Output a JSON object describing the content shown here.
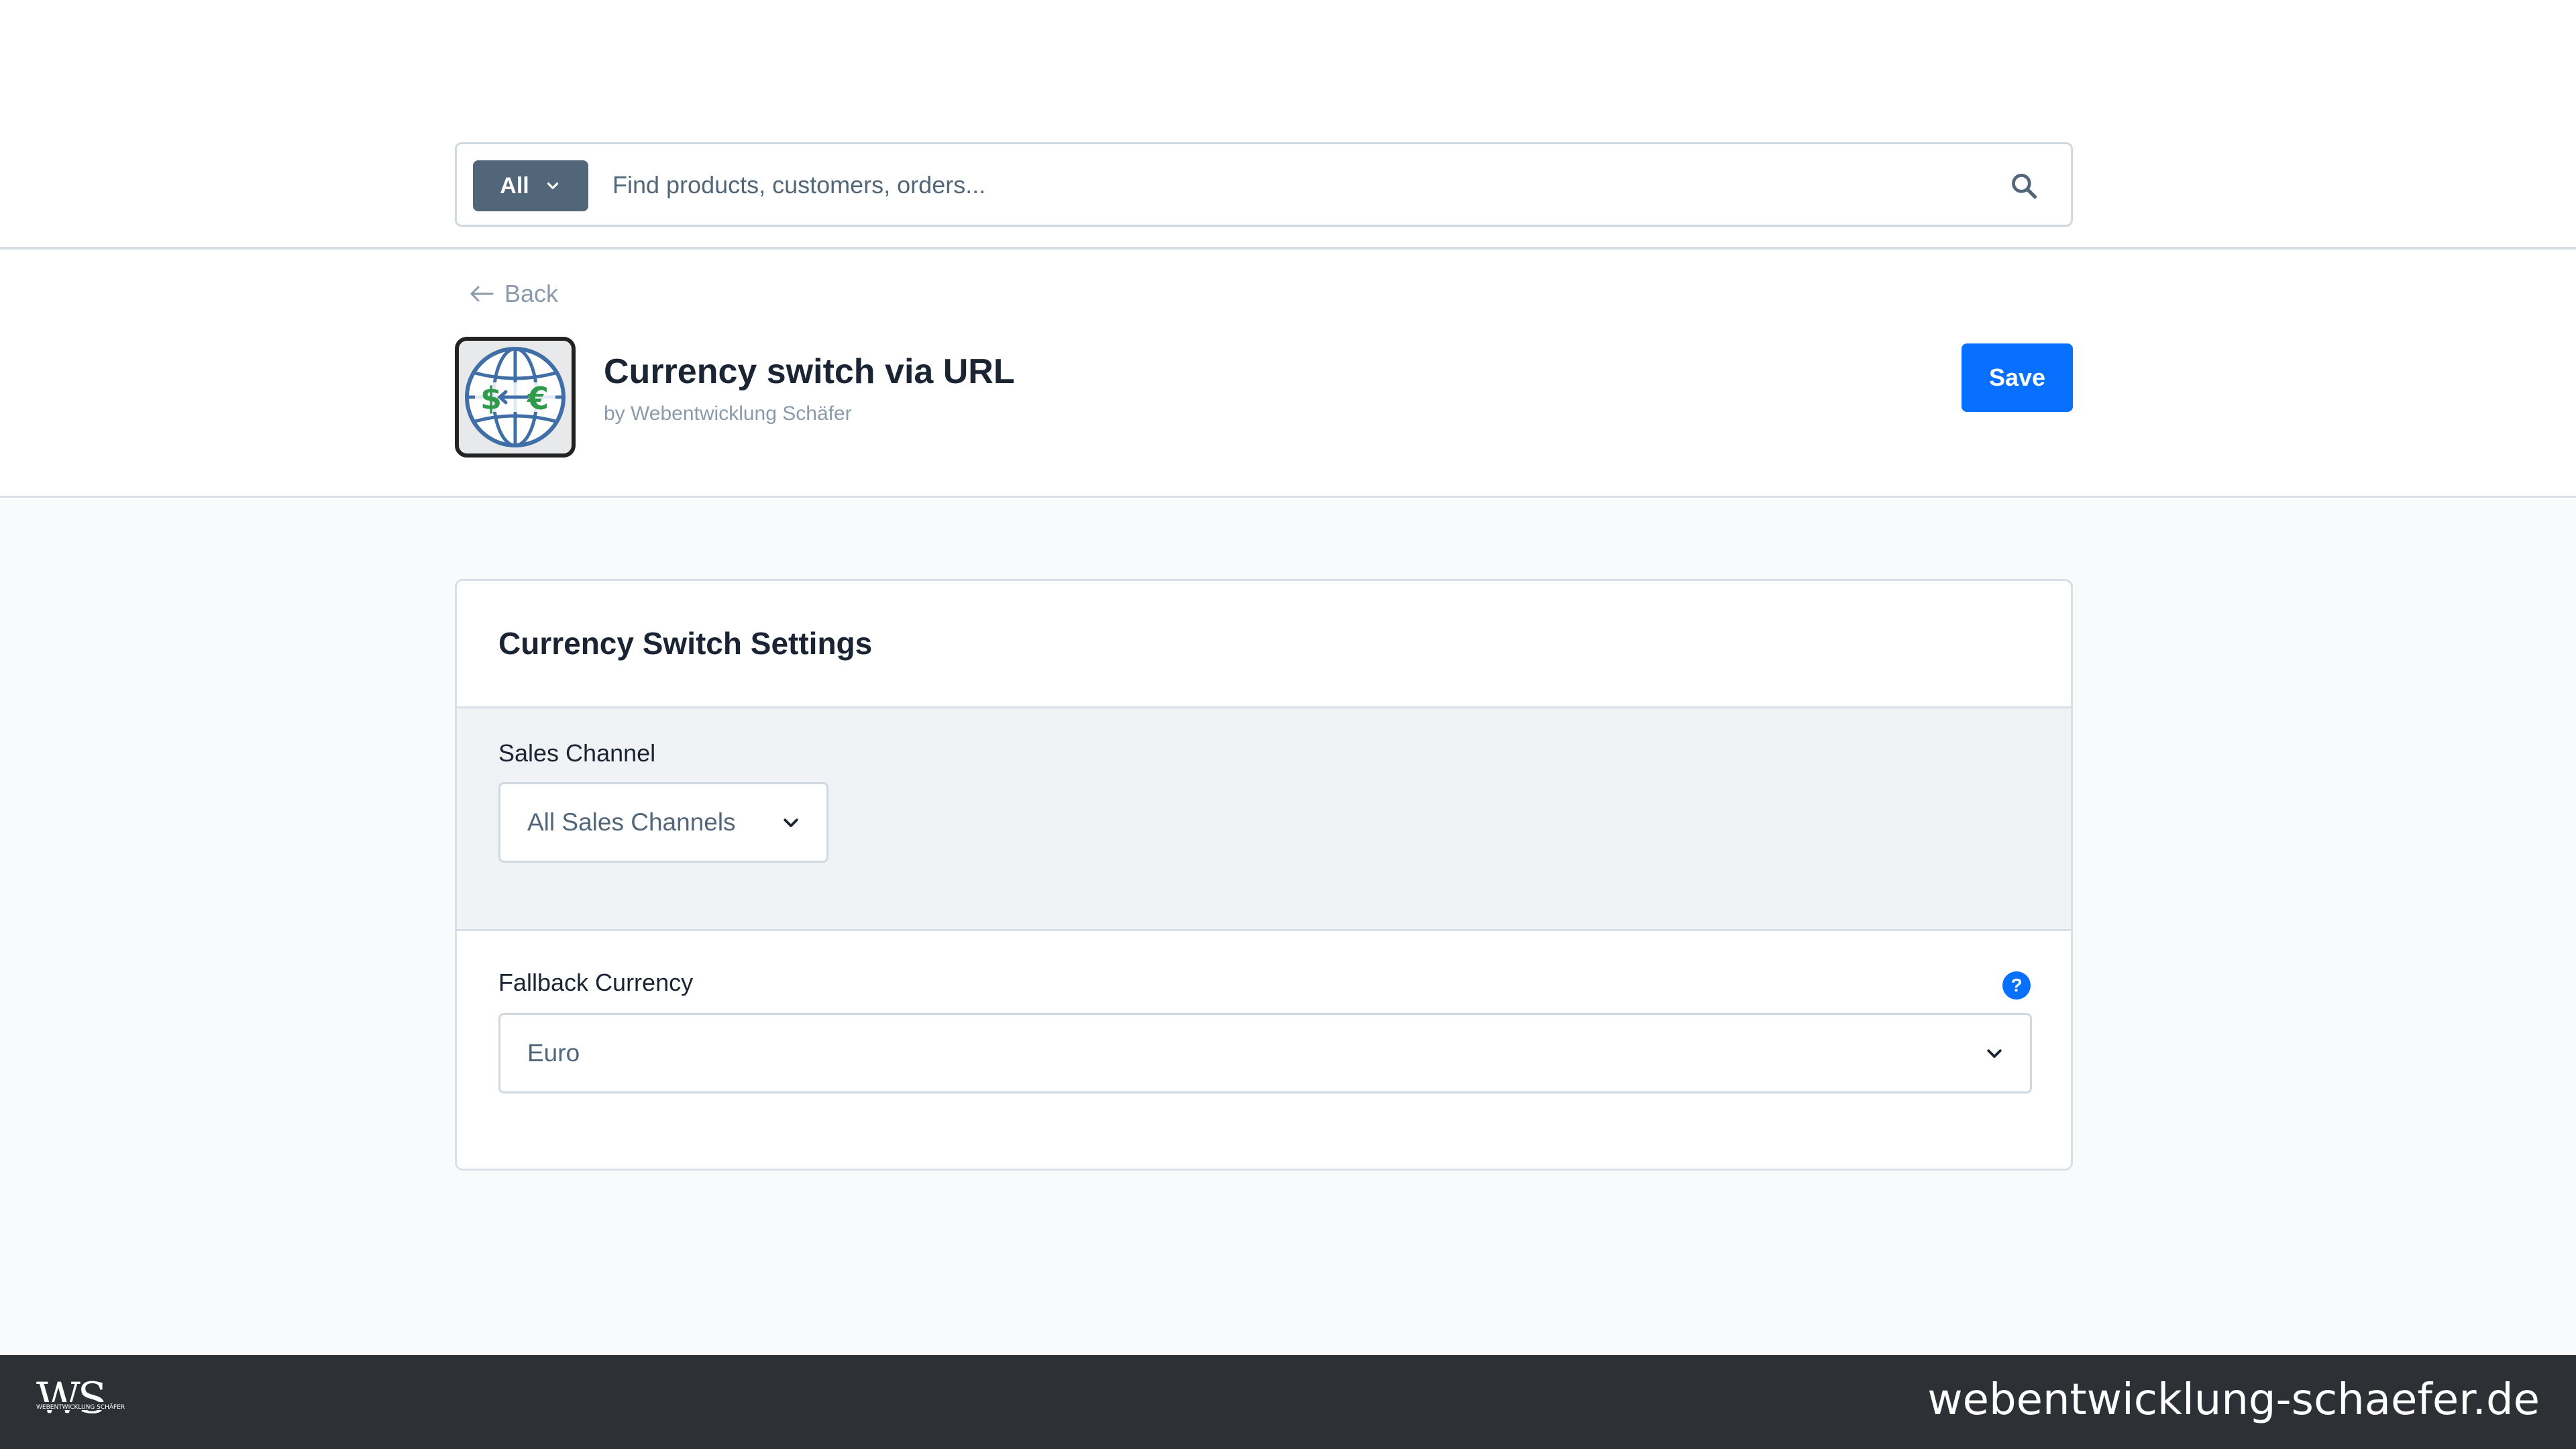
{
  "search": {
    "type_label": "All",
    "placeholder": "Find products, customers, orders..."
  },
  "smartbar": {
    "back_label": "Back",
    "plugin_title": "Currency switch via URL",
    "plugin_author": "by Webentwicklung Schäfer",
    "save_label": "Save"
  },
  "card": {
    "title": "Currency Switch Settings",
    "sales_channel": {
      "label": "Sales Channel",
      "selected": "All Sales Channels"
    },
    "fallback_currency": {
      "label": "Fallback Currency",
      "selected": "Euro",
      "help": "?"
    }
  },
  "footer": {
    "logo_text": "WS",
    "logo_subtext": "WEBENTWICKLUNG SCHÄFER",
    "url": "webentwicklung-schaefer.de"
  },
  "colors": {
    "primary": "#0870ff",
    "search_type_bg": "#52667a",
    "footer_bg": "#2d3136",
    "section_bg": "#f0f2f5",
    "page_bg": "#f9fafb"
  }
}
